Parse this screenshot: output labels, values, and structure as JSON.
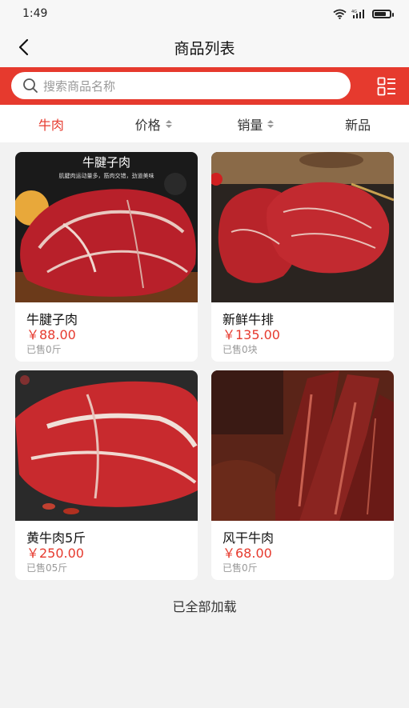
{
  "status_bar": {
    "time": "1:49",
    "icons": [
      "wifi-icon",
      "4g-signal-icon",
      "battery-icon"
    ],
    "battery_level": 0.8
  },
  "nav": {
    "title": "商品列表",
    "back_icon": "chevron-left-icon"
  },
  "search": {
    "placeholder": "搜索商品名称",
    "icon": "search-icon",
    "layout_toggle_icon": "list-view-icon"
  },
  "filters": [
    {
      "label": "牛肉",
      "active": true
    },
    {
      "label": "价格",
      "sortable": true
    },
    {
      "label": "销量",
      "sortable": true
    },
    {
      "label": "新品"
    }
  ],
  "products": [
    {
      "name": "牛腱子肉",
      "price": "￥88.00",
      "sold": "已售0斤",
      "image_banner": "牛腱子肉",
      "image_subtitle": "肌腱肉运动量多，筋肉交错，劲道美味"
    },
    {
      "name": "新鲜牛排",
      "price": "￥135.00",
      "sold": "已售0块"
    },
    {
      "name": "黄牛肉5斤",
      "price": "￥250.00",
      "sold": "已售05斤"
    },
    {
      "name": "风干牛肉",
      "price": "￥68.00",
      "sold": "已售0斤"
    }
  ],
  "footer": {
    "load_end": "已全部加载"
  },
  "colors": {
    "accent": "#e63a2e",
    "background": "#f2f2f2"
  }
}
